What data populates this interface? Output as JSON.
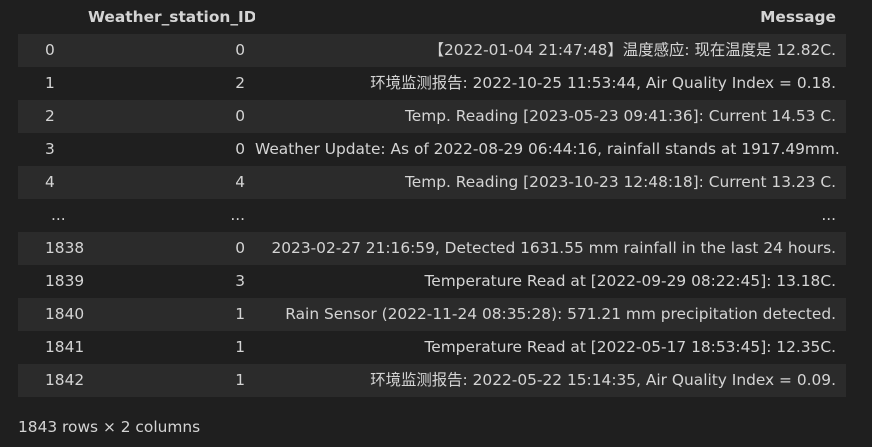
{
  "dataframe": {
    "columns": [
      "",
      "Weather_station_ID",
      "Message"
    ],
    "rows": [
      {
        "index": "0",
        "Weather_station_ID": "0",
        "Message": "【2022-01-04 21:47:48】温度感应: 现在温度是 12.82C."
      },
      {
        "index": "1",
        "Weather_station_ID": "2",
        "Message": "环境监测报告: 2022-10-25 11:53:44, Air Quality Index = 0.18."
      },
      {
        "index": "2",
        "Weather_station_ID": "0",
        "Message": "Temp. Reading [2023-05-23 09:41:36]: Current 14.53 C."
      },
      {
        "index": "3",
        "Weather_station_ID": "0",
        "Message": "Weather Update: As of 2022-08-29 06:44:16, rainfall stands at 1917.49mm."
      },
      {
        "index": "4",
        "Weather_station_ID": "4",
        "Message": "Temp. Reading [2023-10-23 12:48:18]: Current 13.23 C."
      },
      {
        "index": "...",
        "Weather_station_ID": "...",
        "Message": "..."
      },
      {
        "index": "1838",
        "Weather_station_ID": "0",
        "Message": "2023-02-27 21:16:59, Detected 1631.55 mm rainfall in the last 24 hours."
      },
      {
        "index": "1839",
        "Weather_station_ID": "3",
        "Message": "Temperature Read at [2022-09-29 08:22:45]: 13.18C."
      },
      {
        "index": "1840",
        "Weather_station_ID": "1",
        "Message": "Rain Sensor (2022-11-24 08:35:28): 571.21 mm precipitation detected."
      },
      {
        "index": "1841",
        "Weather_station_ID": "1",
        "Message": "Temperature Read at [2022-05-17 18:53:45]: 12.35C."
      },
      {
        "index": "1842",
        "Weather_station_ID": "1",
        "Message": "环境监测报告: 2022-05-22 15:14:35, Air Quality Index = 0.09."
      }
    ],
    "shape_text": "1843 rows × 2 columns"
  },
  "colors": {
    "background": "#1f1f1f",
    "row_alt": "#2b2b2b",
    "text": "#d4d4d4"
  }
}
